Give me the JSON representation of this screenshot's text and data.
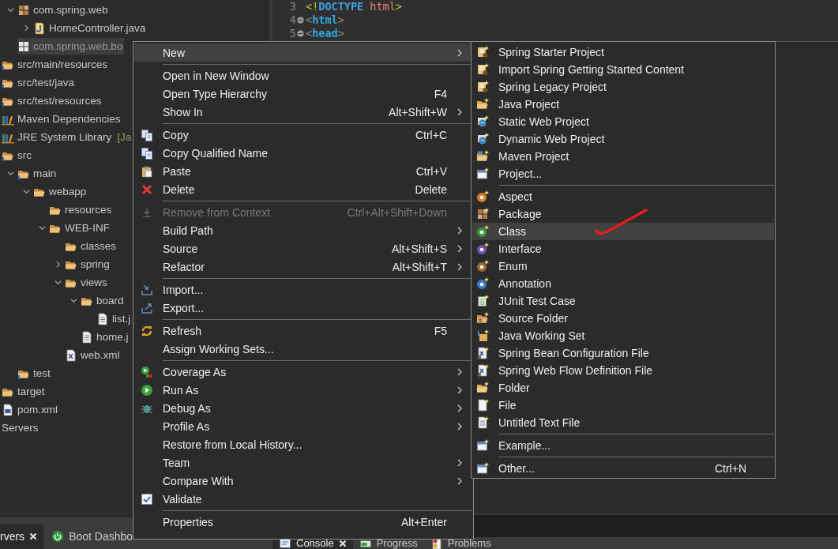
{
  "tree": {
    "items": [
      {
        "children": [
          {
            "label": "com.spring.web",
            "kind": "package",
            "expanded": true,
            "selected": false,
            "children": [
              {
                "label": "HomeController.java",
                "kind": "java-file",
                "expanded": false,
                "selected": false
              }
            ]
          },
          {
            "label": "com.spring.web.bo",
            "kind": "package-empty",
            "selected": true
          }
        ]
      },
      {
        "label": "src/main/resources",
        "kind": "source-folder",
        "selected": false
      },
      {
        "label": "src/test/java",
        "kind": "source-folder",
        "selected": false
      },
      {
        "label": "src/test/resources",
        "kind": "source-folder",
        "selected": false
      },
      {
        "label": "Maven Dependencies",
        "kind": "library",
        "selected": false
      },
      {
        "label": "JRE System Library",
        "decoration": "[Ja",
        "kind": "library",
        "selected": false
      },
      {
        "label": "src",
        "kind": "folder-info",
        "selected": false,
        "children": [
          {
            "label": "main",
            "kind": "folder-info",
            "expanded": true,
            "selected": false,
            "children": [
              {
                "label": "webapp",
                "kind": "folder",
                "expanded": true,
                "selected": false,
                "children": [
                  {
                    "label": "resources",
                    "kind": "folder",
                    "selected": false
                  },
                  {
                    "label": "WEB-INF",
                    "kind": "folder",
                    "expanded": true,
                    "selected": false,
                    "children": [
                      {
                        "label": "classes",
                        "kind": "folder",
                        "selected": false
                      },
                      {
                        "label": "spring",
                        "kind": "folder",
                        "expanded": false,
                        "selected": false
                      },
                      {
                        "label": "views",
                        "kind": "folder",
                        "expanded": true,
                        "selected": false,
                        "children": [
                          {
                            "label": "board",
                            "kind": "folder",
                            "expanded": true,
                            "selected": false,
                            "children": [
                              {
                                "label": "list.j",
                                "kind": "jsp-file",
                                "selected": false
                              }
                            ]
                          },
                          {
                            "label": "home.j",
                            "kind": "jsp-file",
                            "selected": false
                          }
                        ]
                      },
                      {
                        "label": "web.xml",
                        "kind": "xml-doc",
                        "selected": false
                      }
                    ]
                  }
                ]
              }
            ]
          },
          {
            "label": "test",
            "kind": "folder-info",
            "selected": false
          }
        ]
      },
      {
        "label": "target",
        "kind": "folder",
        "selected": false
      },
      {
        "label": "pom.xml",
        "kind": "maven-file",
        "selected": false
      },
      {
        "label": "Servers",
        "kind": "plain",
        "selected": false
      }
    ]
  },
  "left_tabs": [
    {
      "label": "rvers",
      "kind": "plain",
      "selected": true,
      "closable": true
    },
    {
      "label": "Boot Dashbo",
      "kind": "power",
      "selected": false,
      "closable": false
    }
  ],
  "editor": {
    "lines": [
      {
        "number": "3",
        "foldable": false,
        "tokens": [
          {
            "text": "<!",
            "kind": "doctype-punct"
          },
          {
            "text": "DOCTYPE",
            "kind": "doctype-keyword"
          },
          {
            "text": " html",
            "kind": "doctype-name"
          },
          {
            "text": ">",
            "kind": "doctype-punct"
          }
        ]
      },
      {
        "number": "4",
        "foldable": true,
        "tokens": [
          {
            "text": "<",
            "kind": "tag-bracket"
          },
          {
            "text": "html",
            "kind": "tag-name"
          },
          {
            "text": ">",
            "kind": "tag-bracket"
          }
        ]
      },
      {
        "number": "5",
        "foldable": true,
        "tokens": [
          {
            "text": "<",
            "kind": "tag-bracket"
          },
          {
            "text": "head",
            "kind": "tag-name"
          },
          {
            "text": ">",
            "kind": "tag-bracket"
          }
        ]
      }
    ]
  },
  "right_tabs": [
    {
      "label": "Console",
      "kind": "console",
      "selected": true,
      "closable": true
    },
    {
      "label": "Progress",
      "kind": "progress",
      "selected": false,
      "closable": false
    },
    {
      "label": "Problems",
      "kind": "problems",
      "selected": false,
      "closable": false
    }
  ],
  "context_menu": {
    "items": [
      {
        "kind": "plain",
        "label": "New",
        "has_submenu": true,
        "selected": true,
        "disabled": false
      },
      {
        "kind": "separator"
      },
      {
        "kind": "plain",
        "label": "Open in New Window",
        "has_submenu": false,
        "selected": false,
        "disabled": false
      },
      {
        "kind": "plain",
        "label": "Open Type Hierarchy",
        "shortcut": "F4",
        "has_submenu": false,
        "selected": false,
        "disabled": false
      },
      {
        "kind": "plain",
        "label": "Show In",
        "shortcut": "Alt+Shift+W",
        "has_submenu": true,
        "selected": false,
        "disabled": false
      },
      {
        "kind": "separator"
      },
      {
        "kind": "copy",
        "label": "Copy",
        "shortcut": "Ctrl+C",
        "has_submenu": false,
        "selected": false,
        "disabled": false
      },
      {
        "kind": "copy",
        "label": "Copy Qualified Name",
        "has_submenu": false,
        "selected": false,
        "disabled": false
      },
      {
        "kind": "paste",
        "label": "Paste",
        "shortcut": "Ctrl+V",
        "has_submenu": false,
        "selected": false,
        "disabled": false
      },
      {
        "kind": "delete",
        "label": "Delete",
        "shortcut": "Delete",
        "has_submenu": false,
        "selected": false,
        "disabled": false
      },
      {
        "kind": "separator"
      },
      {
        "kind": "remove",
        "label": "Remove from Context",
        "shortcut": "Ctrl+Alt+Shift+Down",
        "has_submenu": false,
        "selected": false,
        "disabled": true
      },
      {
        "kind": "plain",
        "label": "Build Path",
        "has_submenu": true,
        "selected": false,
        "disabled": false
      },
      {
        "kind": "plain",
        "label": "Source",
        "shortcut": "Alt+Shift+S",
        "has_submenu": true,
        "selected": false,
        "disabled": false
      },
      {
        "kind": "plain",
        "label": "Refactor",
        "shortcut": "Alt+Shift+T",
        "has_submenu": true,
        "selected": false,
        "disabled": false
      },
      {
        "kind": "separator"
      },
      {
        "kind": "import",
        "label": "Import...",
        "has_submenu": false,
        "selected": false,
        "disabled": false
      },
      {
        "kind": "export",
        "label": "Export...",
        "has_submenu": false,
        "selected": false,
        "disabled": false
      },
      {
        "kind": "separator"
      },
      {
        "kind": "refresh",
        "label": "Refresh",
        "shortcut": "F5",
        "has_submenu": false,
        "selected": false,
        "disabled": false
      },
      {
        "kind": "plain",
        "label": "Assign Working Sets...",
        "has_submenu": false,
        "selected": false,
        "disabled": false
      },
      {
        "kind": "separator"
      },
      {
        "kind": "coverage",
        "label": "Coverage As",
        "has_submenu": true,
        "selected": false,
        "disabled": false
      },
      {
        "kind": "run",
        "label": "Run As",
        "has_submenu": true,
        "selected": false,
        "disabled": false
      },
      {
        "kind": "debug",
        "label": "Debug As",
        "has_submenu": true,
        "selected": false,
        "disabled": false
      },
      {
        "kind": "plain",
        "label": "Profile As",
        "has_submenu": true,
        "selected": false,
        "disabled": false
      },
      {
        "kind": "plain",
        "label": "Restore from Local History...",
        "has_submenu": false,
        "selected": false,
        "disabled": false
      },
      {
        "kind": "plain",
        "label": "Team",
        "has_submenu": true,
        "selected": false,
        "disabled": false
      },
      {
        "kind": "plain",
        "label": "Compare With",
        "has_submenu": true,
        "selected": false,
        "disabled": false
      },
      {
        "kind": "check",
        "label": "Validate",
        "checked": true,
        "has_submenu": false,
        "selected": false,
        "disabled": false
      },
      {
        "kind": "separator"
      },
      {
        "kind": "plain",
        "label": "Properties",
        "shortcut": "Alt+Enter",
        "has_submenu": false,
        "selected": false,
        "disabled": false
      }
    ]
  },
  "new_submenu": {
    "items": [
      {
        "kind": "spring-project",
        "label": "Spring Starter Project",
        "selected": false
      },
      {
        "kind": "spring-project",
        "label": "Import Spring Getting Started Content",
        "selected": false
      },
      {
        "kind": "spring-project",
        "label": "Spring Legacy Project",
        "selected": false
      },
      {
        "kind": "java-project",
        "label": "Java Project",
        "selected": false
      },
      {
        "kind": "web-project",
        "label": "Static Web Project",
        "selected": false
      },
      {
        "kind": "web-project",
        "label": "Dynamic Web Project",
        "selected": false
      },
      {
        "kind": "maven-project",
        "label": "Maven Project",
        "selected": false
      },
      {
        "kind": "window",
        "label": "Project...",
        "selected": false
      },
      {
        "kind": "separator"
      },
      {
        "kind": "aspect",
        "label": "Aspect",
        "selected": false
      },
      {
        "kind": "new-package",
        "label": "Package",
        "selected": false
      },
      {
        "kind": "class",
        "label": "Class",
        "selected": true
      },
      {
        "kind": "interface",
        "label": "Interface",
        "selected": false
      },
      {
        "kind": "enum",
        "label": "Enum",
        "selected": false
      },
      {
        "kind": "annotation",
        "label": "Annotation",
        "selected": false
      },
      {
        "kind": "junit",
        "label": "JUnit Test Case",
        "selected": false
      },
      {
        "kind": "new-source-folder",
        "label": "Source Folder",
        "selected": false
      },
      {
        "kind": "working-set",
        "label": "Java Working Set",
        "selected": false
      },
      {
        "kind": "xml-file",
        "label": "Spring Bean Configuration File",
        "selected": false
      },
      {
        "kind": "xml-file",
        "label": "Spring Web Flow Definition File",
        "selected": false
      },
      {
        "kind": "new-folder",
        "label": "Folder",
        "selected": false
      },
      {
        "kind": "new-file",
        "label": "File",
        "selected": false
      },
      {
        "kind": "text-file",
        "label": "Untitled Text File",
        "selected": false
      },
      {
        "kind": "separator"
      },
      {
        "kind": "window",
        "label": "Example...",
        "selected": false
      },
      {
        "kind": "separator"
      },
      {
        "kind": "window",
        "label": "Other...",
        "shortcut": "Ctrl+N",
        "selected": false
      }
    ]
  }
}
